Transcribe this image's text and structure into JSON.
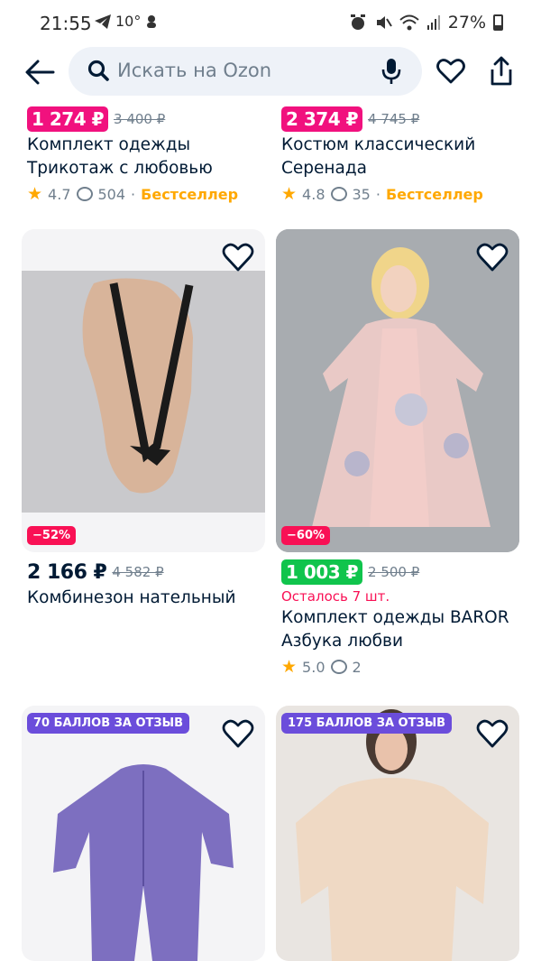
{
  "status": {
    "time": "21:55",
    "temp": "10°",
    "battery": "27%"
  },
  "search": {
    "placeholder": "Искать на Ozon"
  },
  "products": [
    {
      "price": "1 274 ₽",
      "old_price": "3 400 ₽",
      "title_line1": "Комплект одежды",
      "title_line2": "Трикотаж с любовью",
      "rating": "4.7",
      "reviews": "504",
      "badge": "Бестселлер"
    },
    {
      "price": "2 374 ₽",
      "old_price": "4 745 ₽",
      "title_line1": "Костюм классический",
      "title_line2": "Серенада",
      "rating": "4.8",
      "reviews": "35",
      "badge": "Бестселлер"
    },
    {
      "discount": "−52%",
      "price": "2 166 ₽",
      "old_price": "4 582 ₽",
      "title_line1": "Комбинезон нательный"
    },
    {
      "discount": "−60%",
      "price": "1 003 ₽",
      "old_price": "2 500 ₽",
      "stock": "Осталось 7 шт.",
      "title_line1": "Комплект одежды BAROR",
      "title_line2": "Азбука любви",
      "rating": "5.0",
      "reviews": "2"
    },
    {
      "promo": "70 БАЛЛОВ ЗА ОТЗЫВ"
    },
    {
      "promo": "175 БАЛЛОВ ЗА ОТЗЫВ"
    }
  ],
  "separator": "·"
}
